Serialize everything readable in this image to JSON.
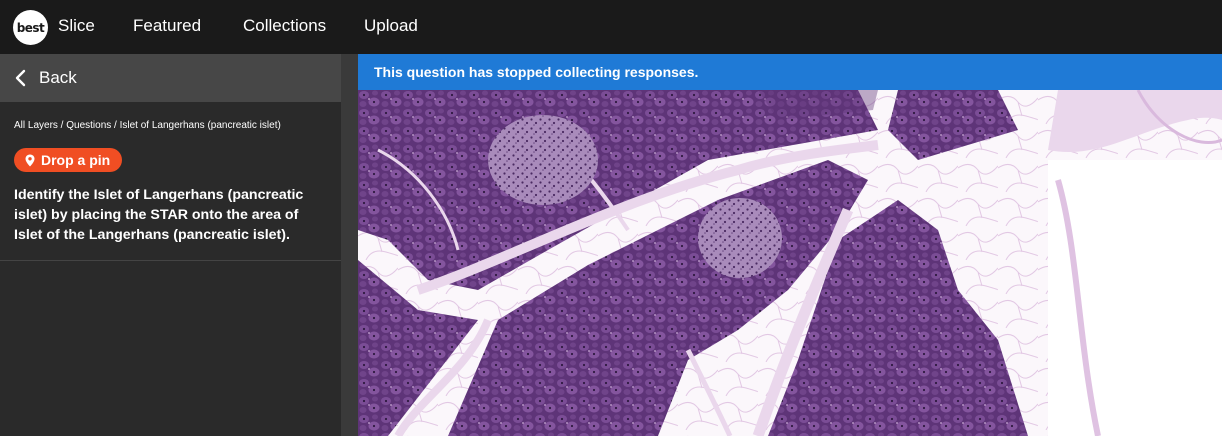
{
  "brand": {
    "logo_text": "best"
  },
  "nav": {
    "items": [
      {
        "label": "Slice"
      },
      {
        "label": "Featured"
      },
      {
        "label": "Collections"
      },
      {
        "label": "Upload"
      }
    ]
  },
  "sidebar": {
    "back_label": "Back",
    "breadcrumb": "All Layers / Questions / Islet of Langerhans (pancreatic islet)",
    "pin_button_label": "Drop a pin",
    "question_text": "Identify the Islet of Langerhans (pancreatic islet) by placing the STAR onto the area of Islet of the Langerhans (pancreatic islet)."
  },
  "notice": {
    "text": "This question has stopped collecting responses."
  },
  "colors": {
    "nav_bg": "#1a1a1a",
    "back_bar_bg": "#474747",
    "sidebar_bg": "#2a2a2a",
    "pin_button": "#f04e23",
    "notice_bg": "#1f7ad6",
    "tissue": "#6b3f86",
    "stroma": "#e9d6ea"
  }
}
